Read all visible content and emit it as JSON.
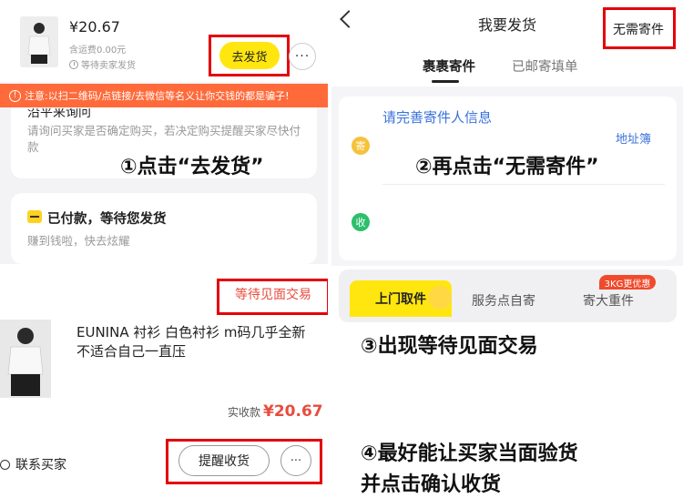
{
  "panel1": {
    "price": "¥20.67",
    "shipping": "含运费0.00元",
    "status": "等待卖家发货",
    "ship_button": "去发货",
    "more_button": "···",
    "warning": "注意:以扫二维码/点链接/去微信等名义让你交钱的都是骗子!",
    "card1_title": "沿平来询问",
    "card1_text": "请询问买家是否确定购买，若决定购买提醒买家尽快付款",
    "step_label": "①点击“去发货”",
    "card2_title": "已付款，等待您发货",
    "card2_text": "赚到钱啦，快去炫耀"
  },
  "panel2": {
    "title": "我要发货",
    "no_send": "无需寄件",
    "tabs": [
      "裹裹寄件",
      "已邮寄填单"
    ],
    "sender_prompt": "请完善寄件人信息",
    "address_book": "地址簿",
    "ji": "寄",
    "shou": "收",
    "step_label": "②再点击“无需寄件”"
  },
  "panel3": {
    "status": "等待见面交易",
    "product_name": "EUNINA 衬衫 白色衬衫 m码几乎全新 不适合自己一直压",
    "actual_label": "实收款",
    "actual_amount": "¥20.67",
    "contact": "联系买家",
    "remind_button": "提醒收货",
    "more_button": "···"
  },
  "panel4": {
    "tabs": [
      "上门取件",
      "服务点自寄",
      "寄大重件"
    ],
    "badge": "3KG更优惠",
    "step3": "③出现等待见面交易",
    "step4_line1": "④最好能让买家当面验货",
    "step4_line2": "并点击确认收货"
  }
}
